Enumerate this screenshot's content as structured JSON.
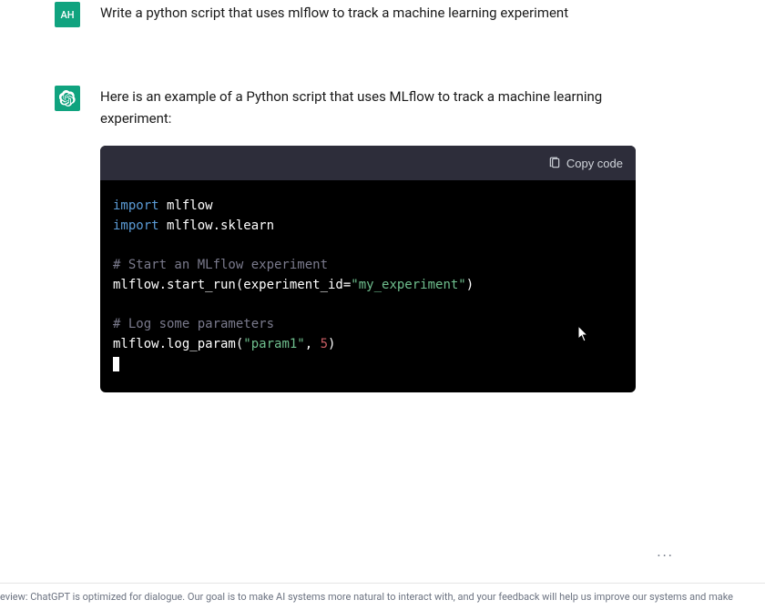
{
  "user": {
    "avatar_text": "AH",
    "message": "Write a python script that uses mlflow to track a machine learning experiment"
  },
  "assistant": {
    "intro": "Here is an example of a Python script that uses MLflow to track a machine learning experiment:",
    "copy_label": "Copy code",
    "code": {
      "l1_kw": "import",
      "l1_mod": " mlflow",
      "l2_kw": "import",
      "l2_mod": " mlflow.sklearn",
      "l4_comment": "# Start an MLflow experiment",
      "l5_a": "mlflow.start_run(experiment_id=",
      "l5_str": "\"my_experiment\"",
      "l5_b": ")",
      "l7_comment": "# Log some parameters",
      "l8_a": "mlflow.log_param(",
      "l8_str": "\"param1\"",
      "l8_b": ", ",
      "l8_num": "5",
      "l8_c": ")"
    }
  },
  "footer_text": "eview: ChatGPT is optimized for dialogue. Our goal is to make AI systems more natural to interact with, and your feedback will help us improve our systems and make",
  "more": "..."
}
